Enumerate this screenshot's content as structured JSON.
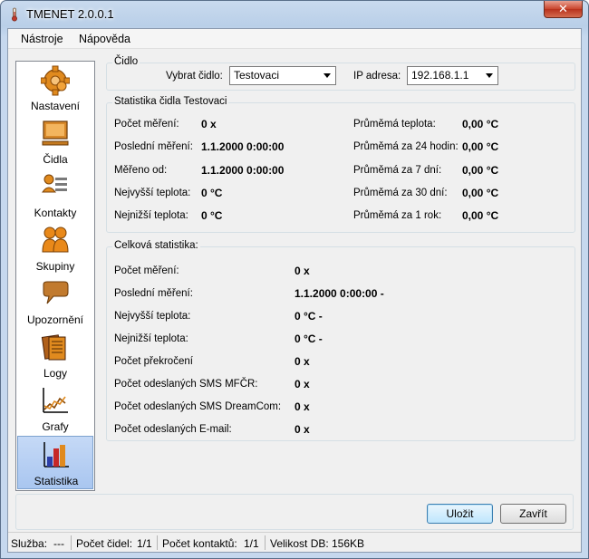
{
  "window": {
    "title": "TMENET 2.0.0.1",
    "close_label": "✕"
  },
  "menu": {
    "items": [
      "Nástroje",
      "Nápověda"
    ]
  },
  "sidebar": {
    "items": [
      {
        "label": "Nastavení",
        "icon": "gear-icon"
      },
      {
        "label": "Čidla",
        "icon": "monitor-icon"
      },
      {
        "label": "Kontakty",
        "icon": "contact-card-icon"
      },
      {
        "label": "Skupiny",
        "icon": "people-group-icon"
      },
      {
        "label": "Upozornění",
        "icon": "speech-bubble-icon"
      },
      {
        "label": "Logy",
        "icon": "documents-icon"
      },
      {
        "label": "Grafy",
        "icon": "line-chart-icon"
      },
      {
        "label": "Statistika",
        "icon": "bar-chart-icon"
      }
    ],
    "active": "Statistika"
  },
  "sensor_group": {
    "title": "Čidlo",
    "select_label": "Vybrat čidlo:",
    "select_value": "Testovaci",
    "ip_label": "IP adresa:",
    "ip_value": "192.168.1.1"
  },
  "sensor_stats": {
    "title": "Statistika čidla Testovaci",
    "left": [
      {
        "label": "Počet měření:",
        "value": "0 x"
      },
      {
        "label": "Poslední měření:",
        "value": "1.1.2000 0:00:00"
      },
      {
        "label": "Měřeno od:",
        "value": "1.1.2000 0:00:00"
      },
      {
        "label": "Nejvyšší teplota:",
        "value": "0 °C"
      },
      {
        "label": "Nejnižší teplota:",
        "value": "0 °C"
      }
    ],
    "right": [
      {
        "label": "Průměmá teplota:",
        "value": "0,00 °C"
      },
      {
        "label": "Průměmá za 24 hodin:",
        "value": "0,00 °C"
      },
      {
        "label": "Průměmá za 7 dní:",
        "value": "0,00 °C"
      },
      {
        "label": "Průměmá za 30 dní:",
        "value": "0,00 °C"
      },
      {
        "label": "Průměmá za 1 rok:",
        "value": "0,00 °C"
      }
    ]
  },
  "total_stats": {
    "title": "Celková statistika:",
    "rows": [
      {
        "label": "Počet měření:",
        "value": "0 x"
      },
      {
        "label": "Poslední měření:",
        "value": "1.1.2000 0:00:00 -"
      },
      {
        "label": "Nejvyšší teplota:",
        "value": "0 °C -"
      },
      {
        "label": "Nejnižší teplota:",
        "value": "0 °C -"
      },
      {
        "label": "Počet překročení",
        "value": "0 x"
      },
      {
        "label": "Počet odeslaných SMS MFČR:",
        "value": "0 x"
      },
      {
        "label": "Počet odeslaných SMS DreamCom:",
        "value": "0 x"
      },
      {
        "label": "Počet odeslaných E-mail:",
        "value": "0 x"
      }
    ]
  },
  "buttons": {
    "save": "Uložit",
    "close": "Zavřít"
  },
  "status": [
    {
      "label": "Služba:",
      "value": "---"
    },
    {
      "label": "Počet čidel:",
      "value": "1/1"
    },
    {
      "label": "Počet kontaktů:",
      "value": "1/1"
    },
    {
      "label": "Velikost DB:",
      "value": "156KB"
    }
  ]
}
